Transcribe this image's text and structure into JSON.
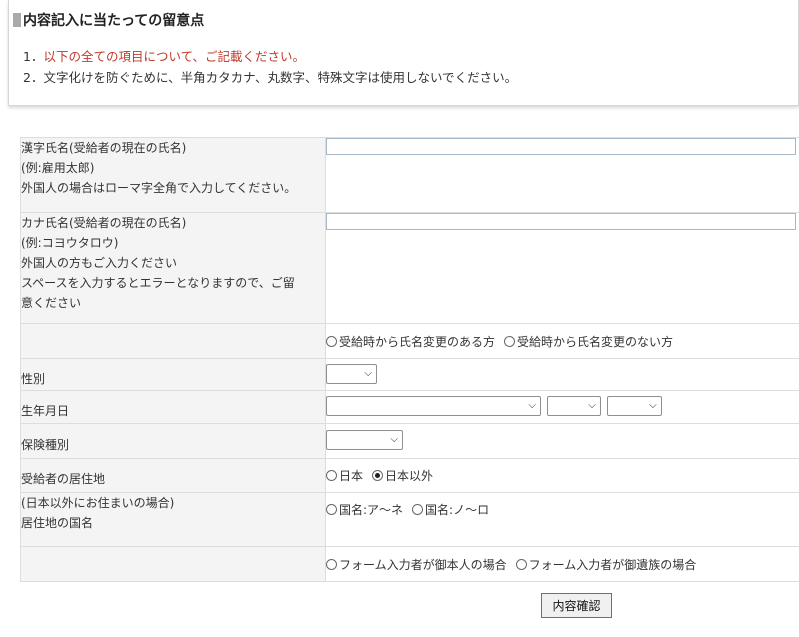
{
  "notice": {
    "title": "内容記入に当たっての留意点",
    "line1_num": "1．",
    "line1_text": "以下の全ての項目について、ご記載ください。",
    "line2": "2．文字化けを防ぐために、半角カタカナ、丸数字、特殊文字は使用しないでください。"
  },
  "colors": {
    "notice_red": "#c0392b",
    "label_bg": "#f4f4f4",
    "border": "#dddddd"
  },
  "rows": {
    "kanji_name": {
      "label1": "漢字氏名(受給者の現在の氏名)",
      "label2": "(例:雇用太郎)",
      "label3": "外国人の場合はローマ字全角で入力してください。",
      "value": ""
    },
    "kana_name": {
      "label1": "カナ氏名(受給者の現在の氏名)",
      "label2": "(例:コヨウタロウ)",
      "label3": "外国人の方もご入力ください",
      "label4": "スペースを入力するとエラーとなりますので、ご留",
      "label5": "意ください",
      "value": ""
    },
    "name_change": {
      "option1": "受給時から氏名変更のある方",
      "option2": "受給時から氏名変更のない方"
    },
    "gender": {
      "label": "性別",
      "selected": ""
    },
    "birthdate": {
      "label": "生年月日",
      "era_selected": "",
      "month_selected": "",
      "day_selected": ""
    },
    "insurance_type": {
      "label": "保険種別",
      "selected": ""
    },
    "residence": {
      "label": "受給者の居住地",
      "option1": "日本",
      "option2": "日本以外",
      "selected": "日本以外"
    },
    "country": {
      "label1": "(日本以外にお住まいの場合)",
      "label2": "居住地の国名",
      "option1": "国名:ア〜ネ",
      "option2": "国名:ノ〜ロ"
    },
    "form_filler": {
      "option1": "フォーム入力者が御本人の場合",
      "option2": "フォーム入力者が御遺族の場合"
    }
  },
  "submit_label": "内容確認",
  "icons": {
    "select_arrow": "chevron-down-icon",
    "title_marker": "square-icon"
  }
}
